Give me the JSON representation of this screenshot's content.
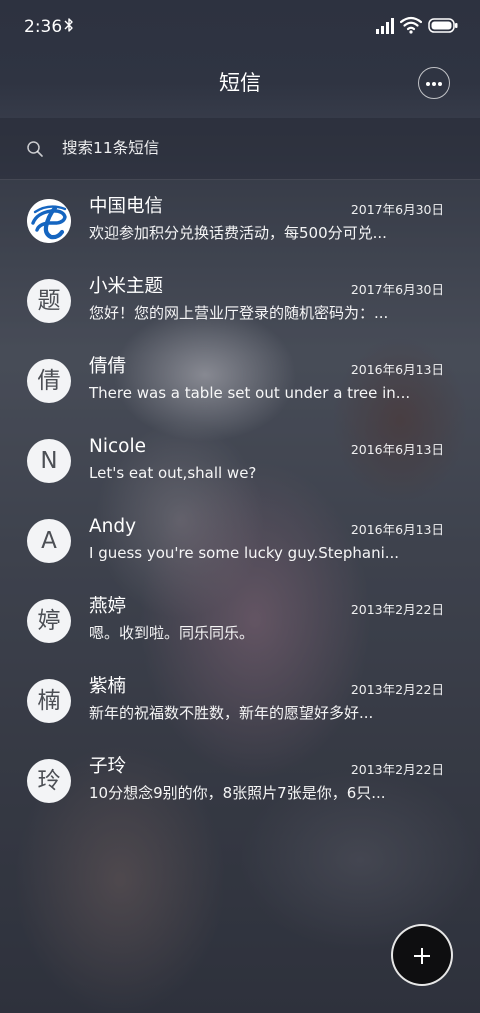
{
  "status_bar": {
    "time": "2:36",
    "icons": [
      "bluetooth-icon",
      "signal-icon",
      "wifi-icon",
      "battery-icon"
    ]
  },
  "header": {
    "title": "短信",
    "menu_icon": "more-icon"
  },
  "search": {
    "placeholder": "搜索11条短信"
  },
  "conversations": [
    {
      "avatar": "",
      "avatar_kind": "china-telecom-logo-icon",
      "name": "中国电信",
      "date": "2017年6月30日",
      "preview": "欢迎参加积分兑换话费活动，每500分可兑..."
    },
    {
      "avatar": "题",
      "name": "小米主题",
      "date": "2017年6月30日",
      "preview": "您好！您的网上营业厅登录的随机密码为：..."
    },
    {
      "avatar": "倩",
      "name": "倩倩",
      "date": "2016年6月13日",
      "preview": "There was a table set out under a tree in..."
    },
    {
      "avatar": "N",
      "name": "Nicole",
      "date": "2016年6月13日",
      "preview": "Let's eat out,shall we?"
    },
    {
      "avatar": "A",
      "name": "Andy",
      "date": "2016年6月13日",
      "preview": "I guess you're some lucky guy.Stephani..."
    },
    {
      "avatar": "婷",
      "name": "燕婷",
      "date": "2013年2月22日",
      "preview": "嗯。收到啦。同乐同乐。"
    },
    {
      "avatar": "楠",
      "name": "紫楠",
      "date": "2013年2月22日",
      "preview": "新年的祝福数不胜数，新年的愿望好多好..."
    },
    {
      "avatar": "玲",
      "name": "子玲",
      "date": "2013年2月22日",
      "preview": "10分想念9别的你，8张照片7张是你，6只..."
    }
  ],
  "compose": {
    "icon": "plus-icon"
  },
  "colors": {
    "header_bg": "#2f3442",
    "fab_bg": "#0e0e10",
    "avatar_bg": "#f3f4f6",
    "telecom_blue": "#1565c0"
  }
}
